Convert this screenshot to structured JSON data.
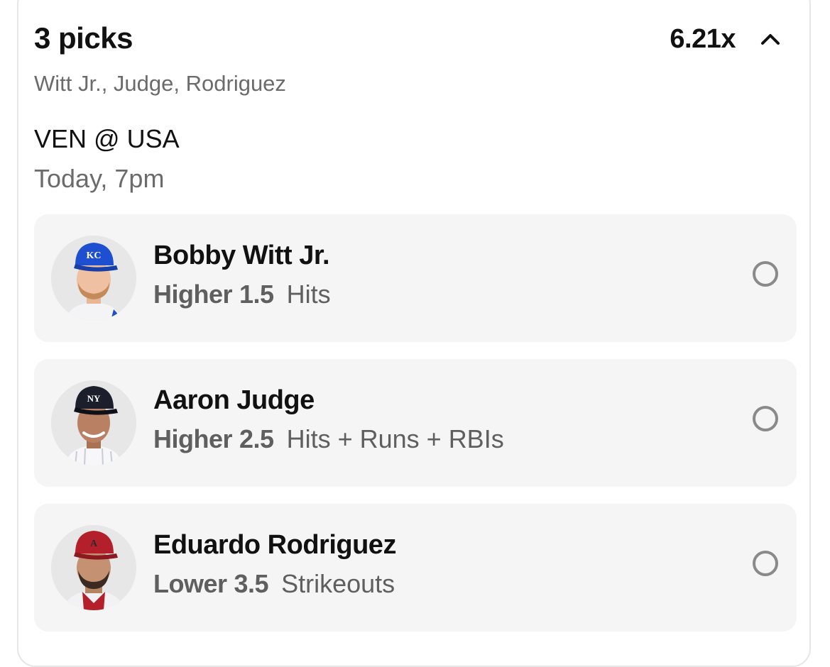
{
  "entry": {
    "title": "3 picks",
    "multiplier": "6.21x",
    "subtitle": "Witt Jr., Judge, Rodriguez",
    "matchup": "VEN @ USA",
    "game_time": "Today, 7pm"
  },
  "picks": [
    {
      "player": "Bobby Witt Jr.",
      "direction": "Higher",
      "line": "1.5",
      "stat": "Hits",
      "cap_color": "#1f4fd1",
      "cap_logo": "KC",
      "selected": false
    },
    {
      "player": "Aaron Judge",
      "direction": "Higher",
      "line": "2.5",
      "stat": "Hits + Runs + RBIs",
      "cap_color": "#1b1e2b",
      "cap_logo": "NY",
      "selected": false
    },
    {
      "player": "Eduardo Rodriguez",
      "direction": "Lower",
      "line": "3.5",
      "stat": "Strikeouts",
      "cap_color": "#b3202c",
      "cap_logo": "A",
      "selected": false
    }
  ],
  "icons": {
    "collapse": "chevron-up-icon",
    "select": "radio-circle-icon"
  }
}
